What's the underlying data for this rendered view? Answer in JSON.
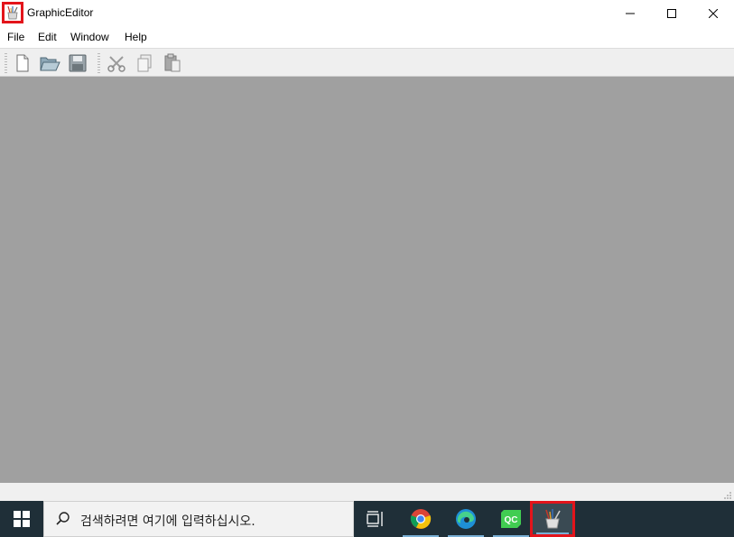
{
  "window": {
    "title": "GraphicEditor",
    "app_icon": "graphic-editor-app-icon",
    "controls": {
      "minimize": "minimize-icon",
      "maximize": "maximize-icon",
      "close": "close-icon"
    }
  },
  "menubar": {
    "items": [
      {
        "label": "File"
      },
      {
        "label": "Edit"
      },
      {
        "label": "Window"
      },
      {
        "label": "Help"
      }
    ]
  },
  "toolbar": {
    "buttons": [
      {
        "icon": "new-file-icon",
        "enabled": true
      },
      {
        "icon": "open-folder-icon",
        "enabled": true
      },
      {
        "icon": "save-icon",
        "enabled": true
      },
      {
        "icon": "cut-icon",
        "enabled": false
      },
      {
        "icon": "copy-icon",
        "enabled": false
      },
      {
        "icon": "paste-icon",
        "enabled": false
      }
    ]
  },
  "colors": {
    "workspace": "#a0a0a0",
    "taskbar": "#1f2f38",
    "highlight": "#e3141b"
  },
  "taskbar": {
    "search": {
      "placeholder": "검색하려면 여기에 입력하십시오.",
      "icon": "search-icon"
    },
    "start_icon": "windows-start-icon",
    "apps": [
      {
        "icon": "task-view-icon"
      },
      {
        "icon": "chrome-icon"
      },
      {
        "icon": "edge-icon"
      },
      {
        "icon": "qt-creator-icon"
      },
      {
        "icon": "graphic-editor-app-icon",
        "active": true
      }
    ]
  }
}
